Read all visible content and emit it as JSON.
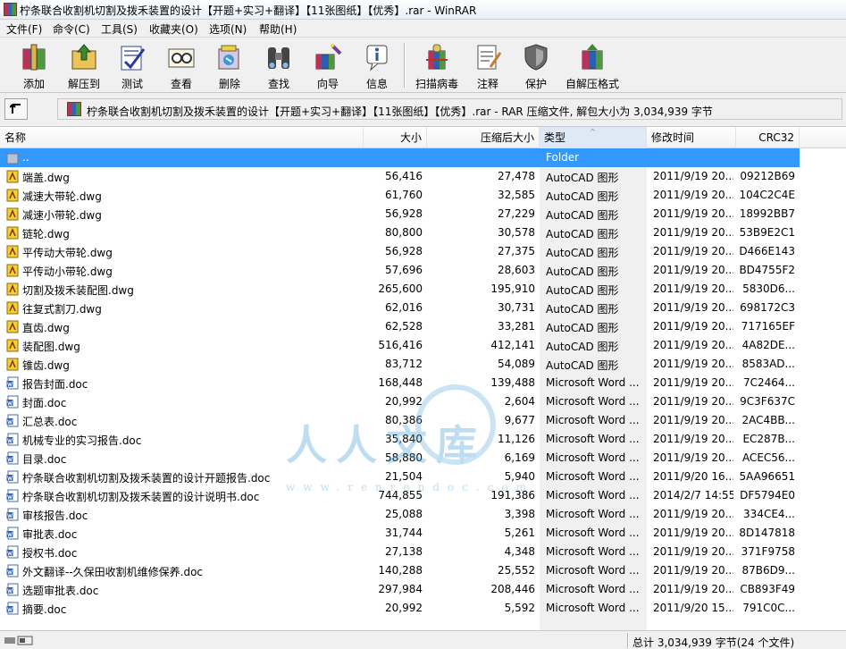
{
  "window": {
    "title": "柠条联合收割机切割及拨禾装置的设计【开题+实习+翻译】【11张图纸】【优秀】.rar - WinRAR"
  },
  "menu": [
    "文件(F)",
    "命令(C)",
    "工具(S)",
    "收藏夹(O)",
    "选项(N)",
    "帮助(H)"
  ],
  "toolbar": [
    {
      "label": "添加",
      "icon": "add-archive-icon"
    },
    {
      "label": "解压到",
      "icon": "extract-to-icon"
    },
    {
      "label": "测试",
      "icon": "test-icon"
    },
    {
      "label": "查看",
      "icon": "view-icon"
    },
    {
      "label": "删除",
      "icon": "delete-icon"
    },
    {
      "label": "查找",
      "icon": "find-binoculars-icon"
    },
    {
      "label": "向导",
      "icon": "wizard-icon"
    },
    {
      "label": "信息",
      "icon": "info-icon"
    },
    {
      "label": "扫描病毒",
      "icon": "virus-scan-icon"
    },
    {
      "label": "注释",
      "icon": "comment-icon"
    },
    {
      "label": "保护",
      "icon": "protect-shield-icon"
    },
    {
      "label": "自解压格式",
      "icon": "sfx-icon"
    }
  ],
  "address": {
    "text": "柠条联合收割机切割及拨禾装置的设计【开题+实习+翻译】【11张图纸】【优秀】.rar - RAR 压缩文件, 解包大小为 3,034,939 字节"
  },
  "columns": {
    "name": "名称",
    "size": "大小",
    "packed": "压缩后大小",
    "type": "类型",
    "modified": "修改时间",
    "crc": "CRC32"
  },
  "parent_row": {
    "name": "..",
    "type": "Folder"
  },
  "files": [
    {
      "name": "端盖.dwg",
      "size": "56,416",
      "packed": "27,478",
      "type": "AutoCAD 图形",
      "modified": "2011/9/19 20...",
      "crc": "09212B69",
      "kind": "dwg"
    },
    {
      "name": "减速大带轮.dwg",
      "size": "61,760",
      "packed": "32,585",
      "type": "AutoCAD 图形",
      "modified": "2011/9/19 20...",
      "crc": "104C2C4E",
      "kind": "dwg"
    },
    {
      "name": "减速小带轮.dwg",
      "size": "56,928",
      "packed": "27,229",
      "type": "AutoCAD 图形",
      "modified": "2011/9/19 20...",
      "crc": "18992BB7",
      "kind": "dwg"
    },
    {
      "name": "链轮.dwg",
      "size": "80,800",
      "packed": "30,578",
      "type": "AutoCAD 图形",
      "modified": "2011/9/19 20...",
      "crc": "53B9E2C1",
      "kind": "dwg"
    },
    {
      "name": "平传动大带轮.dwg",
      "size": "56,928",
      "packed": "27,375",
      "type": "AutoCAD 图形",
      "modified": "2011/9/19 20...",
      "crc": "D466E143",
      "kind": "dwg"
    },
    {
      "name": "平传动小带轮.dwg",
      "size": "57,696",
      "packed": "28,603",
      "type": "AutoCAD 图形",
      "modified": "2011/9/19 20...",
      "crc": "BD4755F2",
      "kind": "dwg"
    },
    {
      "name": "切割及拨禾装配图.dwg",
      "size": "265,600",
      "packed": "195,910",
      "type": "AutoCAD 图形",
      "modified": "2011/9/19 20...",
      "crc": "5830D6...",
      "kind": "dwg"
    },
    {
      "name": "往复式割刀.dwg",
      "size": "62,016",
      "packed": "30,731",
      "type": "AutoCAD 图形",
      "modified": "2011/9/19 20...",
      "crc": "698172C3",
      "kind": "dwg"
    },
    {
      "name": "直齿.dwg",
      "size": "62,528",
      "packed": "33,281",
      "type": "AutoCAD 图形",
      "modified": "2011/9/19 20...",
      "crc": "717165EF",
      "kind": "dwg"
    },
    {
      "name": "装配图.dwg",
      "size": "516,416",
      "packed": "412,141",
      "type": "AutoCAD 图形",
      "modified": "2011/9/19 20...",
      "crc": "4A82DE...",
      "kind": "dwg"
    },
    {
      "name": "锥齿.dwg",
      "size": "83,712",
      "packed": "54,089",
      "type": "AutoCAD 图形",
      "modified": "2011/9/19 20...",
      "crc": "8583AD...",
      "kind": "dwg"
    },
    {
      "name": "报告封面.doc",
      "size": "168,448",
      "packed": "139,488",
      "type": "Microsoft Word ...",
      "modified": "2011/9/19 20...",
      "crc": "7C2464...",
      "kind": "doc"
    },
    {
      "name": "封面.doc",
      "size": "20,992",
      "packed": "2,604",
      "type": "Microsoft Word ...",
      "modified": "2011/9/19 20...",
      "crc": "9C3F637C",
      "kind": "doc"
    },
    {
      "name": "汇总表.doc",
      "size": "80,386",
      "packed": "9,677",
      "type": "Microsoft Word ...",
      "modified": "2011/9/19 20...",
      "crc": "2AC4BB...",
      "kind": "doc"
    },
    {
      "name": "机械专业的实习报告.doc",
      "size": "35,840",
      "packed": "11,126",
      "type": "Microsoft Word ...",
      "modified": "2011/9/19 20...",
      "crc": "EC287B...",
      "kind": "doc"
    },
    {
      "name": "目录.doc",
      "size": "58,880",
      "packed": "6,169",
      "type": "Microsoft Word ...",
      "modified": "2011/9/19 20...",
      "crc": "ACEC56...",
      "kind": "doc"
    },
    {
      "name": "柠条联合收割机切割及拨禾装置的设计开题报告.doc",
      "size": "21,504",
      "packed": "5,940",
      "type": "Microsoft Word ...",
      "modified": "2011/9/20 16...",
      "crc": "5AA96651",
      "kind": "doc"
    },
    {
      "name": "柠条联合收割机切割及拨禾装置的设计说明书.doc",
      "size": "744,855",
      "packed": "191,386",
      "type": "Microsoft Word ...",
      "modified": "2014/2/7 14:55",
      "crc": "DF5794E0",
      "kind": "doc"
    },
    {
      "name": "审核报告.doc",
      "size": "25,088",
      "packed": "3,398",
      "type": "Microsoft Word ...",
      "modified": "2011/9/19 20...",
      "crc": "334CE4...",
      "kind": "doc"
    },
    {
      "name": "审批表.doc",
      "size": "31,744",
      "packed": "5,261",
      "type": "Microsoft Word ...",
      "modified": "2011/9/19 20...",
      "crc": "8D147818",
      "kind": "doc"
    },
    {
      "name": "授权书.doc",
      "size": "27,138",
      "packed": "4,348",
      "type": "Microsoft Word ...",
      "modified": "2011/9/19 20...",
      "crc": "371F9758",
      "kind": "doc"
    },
    {
      "name": "外文翻译--久保田收割机维修保养.doc",
      "size": "140,288",
      "packed": "25,552",
      "type": "Microsoft Word ...",
      "modified": "2011/9/19 20...",
      "crc": "87B6D9...",
      "kind": "doc"
    },
    {
      "name": "选题审批表.doc",
      "size": "297,984",
      "packed": "208,446",
      "type": "Microsoft Word ...",
      "modified": "2011/9/19 20...",
      "crc": "CB893F49",
      "kind": "doc"
    },
    {
      "name": "摘要.doc",
      "size": "20,992",
      "packed": "5,592",
      "type": "Microsoft Word ...",
      "modified": "2011/9/20 15...",
      "crc": "791C0C...",
      "kind": "doc"
    }
  ],
  "watermark": {
    "text": "人人文库",
    "url": "www.renrendoc.com"
  },
  "status": {
    "total": "总计 3,034,939 字节(24 个文件)"
  }
}
